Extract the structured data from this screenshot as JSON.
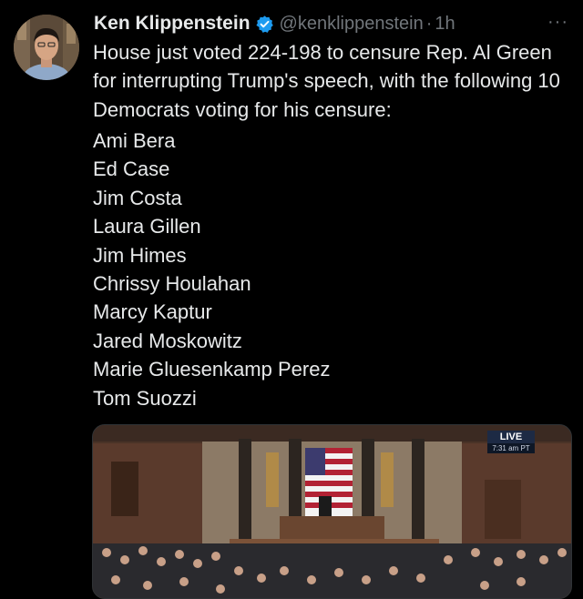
{
  "tweet": {
    "author_name": "Ken Klippenstein",
    "handle": "@kenklippenstein",
    "separator": "·",
    "time": "1h",
    "more": "···",
    "text": "House just voted 224-198 to censure Rep. Al Green for interrupting Trump's speech, with the following 10 Democrats voting for his censure:",
    "names": [
      "Ami Bera",
      "Ed Case",
      "Jim Costa",
      "Laura Gillen",
      "Jim Himes",
      "Chrissy Houlahan",
      "Marcy Kaptur",
      "Jared Moskowitz",
      "Marie Gluesenkamp Perez",
      "Tom Suozzi"
    ]
  },
  "media": {
    "live_label": "LIVE",
    "live_time": "7:31 am PT"
  },
  "colors": {
    "background": "#000000",
    "text": "#e7e9ea",
    "muted": "#71767b",
    "verified": "#1d9bf0"
  },
  "icons": {
    "verified": "verified-badge-icon",
    "more": "more-options-icon"
  }
}
